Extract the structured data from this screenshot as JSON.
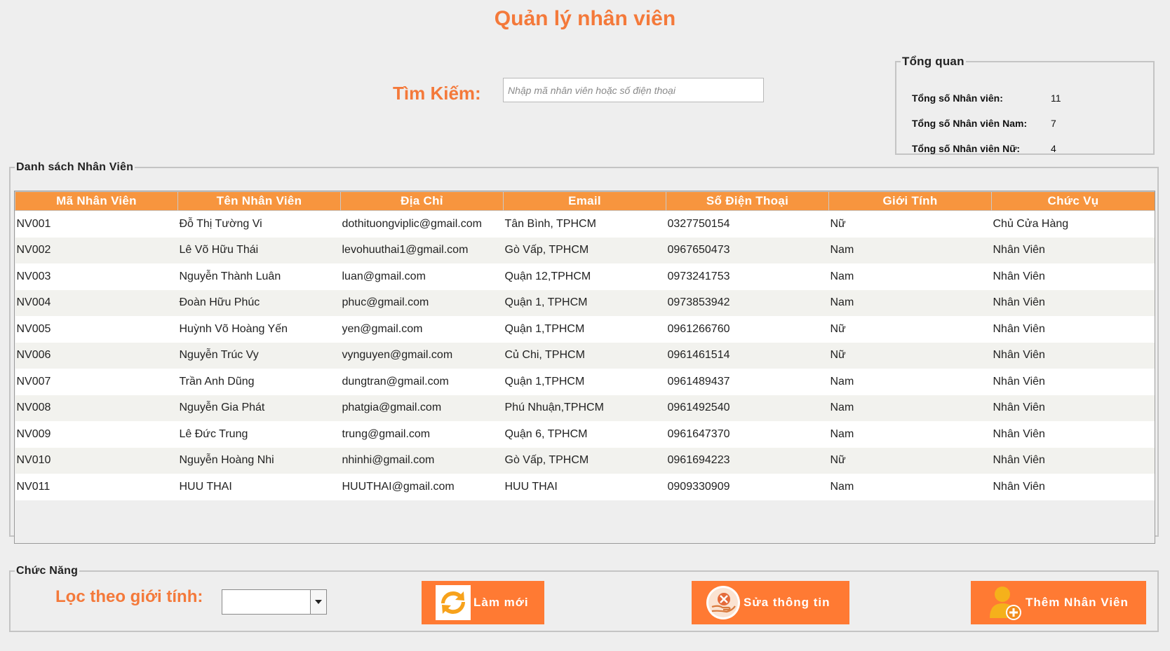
{
  "header": {
    "title": "Quản lý nhân viên"
  },
  "search": {
    "label": "Tìm Kiếm:",
    "placeholder": "Nhập mã nhân viên hoặc số điện thoại",
    "value": ""
  },
  "overview": {
    "legend": "Tổng quan",
    "rows": [
      {
        "label": "Tổng số Nhân viên:",
        "value": "11"
      },
      {
        "label": "Tổng số Nhân viên Nam:",
        "value": "7"
      },
      {
        "label": "Tổng số Nhân viên Nữ:",
        "value": "4"
      }
    ]
  },
  "employee_list": {
    "legend": "Danh sách Nhân Viên",
    "columns": [
      "Mã Nhân Viên",
      "Tên Nhân Viên",
      "Địa Chỉ",
      "Email",
      "Số Điện Thoại",
      "Giới Tính",
      "Chức Vụ"
    ],
    "rows": [
      [
        "NV001",
        "Đỗ Thị Tường Vi",
        "dothituongviplic@gmail.com",
        "Tân Bình, TPHCM",
        "0327750154",
        "Nữ",
        "Chủ Cửa Hàng"
      ],
      [
        "NV002",
        "Lê Võ Hữu Thái",
        "levohuuthai1@gmail.com",
        "Gò Vấp, TPHCM",
        "0967650473",
        "Nam",
        "Nhân Viên"
      ],
      [
        "NV003",
        "Nguyễn Thành Luân",
        "luan@gmail.com",
        "Quận 12,TPHCM",
        "0973241753",
        "Nam",
        "Nhân Viên"
      ],
      [
        "NV004",
        "Đoàn Hữu Phúc",
        "phuc@gmail.com",
        "Quận 1, TPHCM",
        "0973853942",
        "Nam",
        "Nhân Viên"
      ],
      [
        "NV005",
        "Huỳnh Võ Hoàng Yến",
        "yen@gmail.com",
        "Quận 1,TPHCM",
        "0961266760",
        "Nữ",
        "Nhân Viên"
      ],
      [
        "NV006",
        "Nguyễn Trúc Vy",
        "vynguyen@gmail.com",
        "Củ Chi, TPHCM",
        "0961461514",
        "Nữ",
        "Nhân Viên"
      ],
      [
        "NV007",
        "Trần Anh Dũng",
        "dungtran@gmail.com",
        "Quận 1,TPHCM",
        "0961489437",
        "Nam",
        "Nhân Viên"
      ],
      [
        "NV008",
        "Nguyễn Gia Phát",
        "phatgia@gmail.com",
        "Phú Nhuận,TPHCM",
        "0961492540",
        "Nam",
        "Nhân Viên"
      ],
      [
        "NV009",
        "Lê Đức Trung",
        "trung@gmail.com",
        "Quận 6, TPHCM",
        "0961647370",
        "Nam",
        "Nhân Viên"
      ],
      [
        "NV010",
        "Nguyễn Hoàng Nhi",
        "nhinhi@gmail.com",
        "Gò Vấp, TPHCM",
        "0961694223",
        "Nữ",
        "Nhân Viên"
      ],
      [
        "NV011",
        "HUU THAI",
        "HUUTHAI@gmail.com",
        "HUU THAI",
        "0909330909",
        "Nam",
        "Nhân Viên"
      ]
    ]
  },
  "functions": {
    "legend": "Chức Năng",
    "filter_label": "Lọc theo giới tính:",
    "filter_value": "",
    "refresh_label": "Làm mới",
    "edit_label": "Sửa thông tin",
    "add_label": "Thêm Nhân Viên",
    "refresh_icon": "refresh-icon",
    "edit_icon": "edit-info-icon",
    "add_icon": "add-user-icon"
  },
  "colors": {
    "accent": "#f4793a",
    "header_bg": "#f7953e",
    "button_bg": "#ff7a33"
  }
}
